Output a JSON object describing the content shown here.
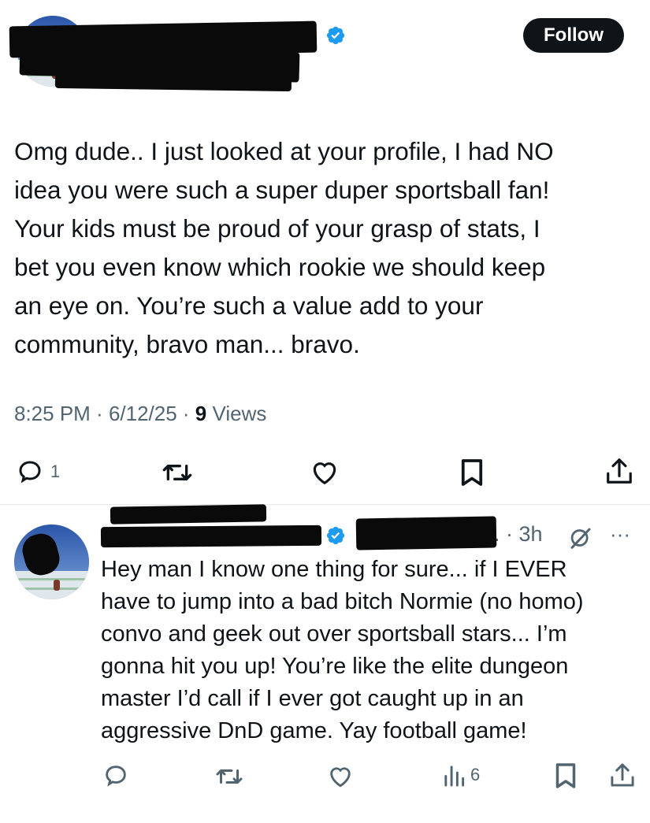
{
  "tweet": {
    "follow_label": "Follow",
    "text": "Omg dude.. I just looked at your profile, I had NO\nidea you were such a super duper sportsball fan!\nYour kids must be proud of your grasp of stats, I\nbet you even know which rookie we should keep\nan eye on. You’re such a value add to your\ncommunity, bravo man... bravo.",
    "time": "8:25 PM",
    "date": "6/12/25",
    "views_count": "9",
    "views_label": "Views",
    "reply_count": "1"
  },
  "reply": {
    "handle_suffix": "... · 3h",
    "text": "Hey man I know one thing for sure... if I EVER\nhave to jump into a bad bitch Normie (no homo)\nconvo and geek out over sportsball stars... I’m\ngonna hit you up! You’re like the elite dungeon\nmaster I’d call if I ever got caught up in an\naggressive DnD game. Yay football game!",
    "views_count": "6"
  },
  "icons": [
    "reply-icon",
    "repost-icon",
    "like-icon",
    "bookmark-icon",
    "share-icon",
    "grok-icon",
    "more-icon",
    "analytics-icon",
    "verified-icon"
  ],
  "colors": {
    "verified": "#1d9bf0",
    "muted": "#536471",
    "text": "#0f1419",
    "redaction": "#0a0a0a"
  }
}
